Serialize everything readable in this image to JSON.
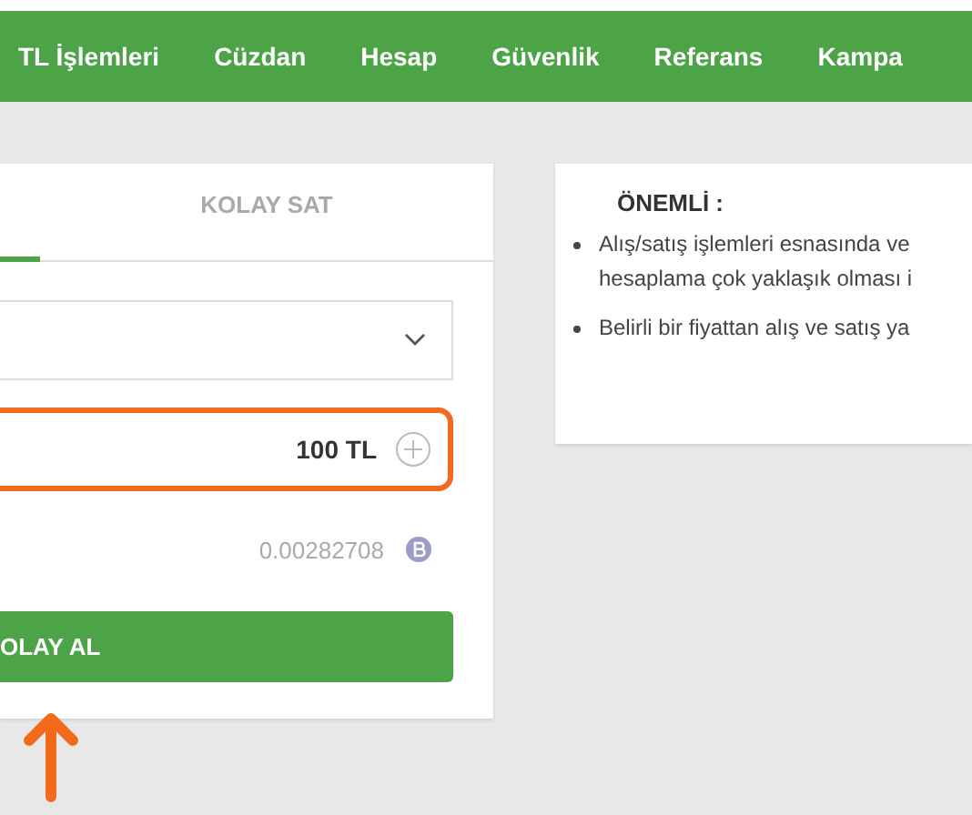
{
  "nav": [
    "TL İşlemleri",
    "Cüzdan",
    "Hesap",
    "Güvenlik",
    "Referans",
    "Kampa"
  ],
  "trade_card": {
    "tabs": [
      {
        "selected": true
      },
      {
        "label": "KOLAY SAT",
        "selected": false
      }
    ],
    "amount": "100 TL",
    "result": "0.00282708",
    "submit": "OLAY AL"
  },
  "notice": {
    "title": "ÖNEMLİ :",
    "items": [
      {
        "lines": [
          "Alış/satış işlemleri esnasında ve",
          "hesaplama çok yaklaşık olması i"
        ]
      },
      {
        "lines": [
          "Belirli bir fiyattan alış ve satış ya"
        ]
      }
    ]
  }
}
